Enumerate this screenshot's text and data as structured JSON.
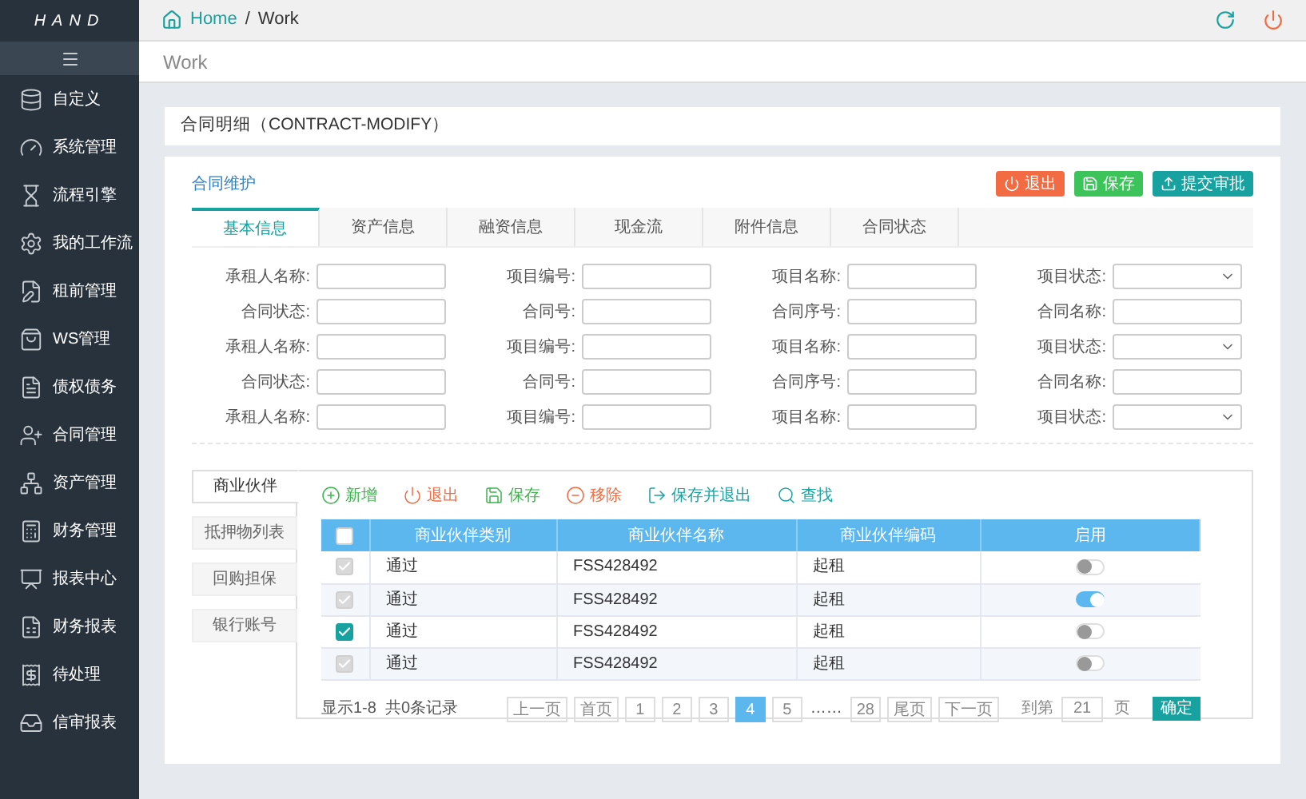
{
  "logo": {
    "text": "HAND"
  },
  "breadcrumb": {
    "home": "Home",
    "separator": "/",
    "current": "Work"
  },
  "page_title": "Work",
  "sidebar": {
    "items": [
      {
        "label": "自定义"
      },
      {
        "label": "系统管理"
      },
      {
        "label": "流程引擎"
      },
      {
        "label": "我的工作流"
      },
      {
        "label": "租前管理"
      },
      {
        "label": "WS管理"
      },
      {
        "label": "债权债务"
      },
      {
        "label": "合同管理"
      },
      {
        "label": "资产管理"
      },
      {
        "label": "财务管理"
      },
      {
        "label": "报表中心"
      },
      {
        "label": "财务报表"
      },
      {
        "label": "待处理"
      },
      {
        "label": "信审报表"
      }
    ]
  },
  "detail_title": "合同明细（CONTRACT-MODIFY）",
  "section_title": "合同维护",
  "actions": [
    {
      "label": "退出",
      "kind": "exit"
    },
    {
      "label": "保存",
      "kind": "save"
    },
    {
      "label": "提交审批",
      "kind": "submit"
    }
  ],
  "tabs": [
    {
      "label": "基本信息",
      "selected": true
    },
    {
      "label": "资产信息",
      "selected": false
    },
    {
      "label": "融资信息",
      "selected": false
    },
    {
      "label": "现金流",
      "selected": false
    },
    {
      "label": "附件信息",
      "selected": false
    },
    {
      "label": "合同状态",
      "selected": false
    }
  ],
  "form_rows": [
    [
      {
        "label": "承租人名称:",
        "kind": "input"
      },
      {
        "label": "项目编号:",
        "kind": "input"
      },
      {
        "label": "项目名称:",
        "kind": "input"
      },
      {
        "label": "项目状态:",
        "kind": "select"
      }
    ],
    [
      {
        "label": "合同状态:",
        "kind": "input"
      },
      {
        "label": "合同号:",
        "kind": "input"
      },
      {
        "label": "合同序号:",
        "kind": "input"
      },
      {
        "label": "合同名称:",
        "kind": "input"
      }
    ],
    [
      {
        "label": "承租人名称:",
        "kind": "input"
      },
      {
        "label": "项目编号:",
        "kind": "input"
      },
      {
        "label": "项目名称:",
        "kind": "input"
      },
      {
        "label": "项目状态:",
        "kind": "select"
      }
    ],
    [
      {
        "label": "合同状态:",
        "kind": "input"
      },
      {
        "label": "合同号:",
        "kind": "input"
      },
      {
        "label": "合同序号:",
        "kind": "input"
      },
      {
        "label": "合同名称:",
        "kind": "input"
      }
    ],
    [
      {
        "label": "承租人名称:",
        "kind": "input"
      },
      {
        "label": "项目编号:",
        "kind": "input"
      },
      {
        "label": "项目名称:",
        "kind": "input"
      },
      {
        "label": "项目状态:",
        "kind": "select"
      }
    ]
  ],
  "side_tabs": [
    {
      "label": "商业伙伴",
      "selected": true
    },
    {
      "label": "抵押物列表",
      "selected": false
    },
    {
      "label": "回购担保",
      "selected": false
    },
    {
      "label": "银行账号",
      "selected": false
    }
  ],
  "toolbar": [
    {
      "label": "新增",
      "kind": "add"
    },
    {
      "label": "退出",
      "kind": "exit"
    },
    {
      "label": "保存",
      "kind": "save"
    },
    {
      "label": "移除",
      "kind": "remove"
    },
    {
      "label": "保存并退出",
      "kind": "save_exit"
    },
    {
      "label": "查找",
      "kind": "search"
    }
  ],
  "table": {
    "columns": [
      "商业伙伴类别",
      "商业伙伴名称",
      "商业伙伴编码",
      "启用"
    ],
    "header_checked": false,
    "rows": [
      {
        "checked": true,
        "disabled": true,
        "type": "通过",
        "name": "FSS428492",
        "code": "起租",
        "on": false
      },
      {
        "checked": true,
        "disabled": true,
        "type": "通过",
        "name": "FSS428492",
        "code": "起租",
        "on": true
      },
      {
        "checked": true,
        "disabled": false,
        "type": "通过",
        "name": "FSS428492",
        "code": "起租",
        "on": false
      },
      {
        "checked": true,
        "disabled": true,
        "type": "通过",
        "name": "FSS428492",
        "code": "起租",
        "on": false
      }
    ]
  },
  "footer": {
    "summary": "显示1-8  共0条记录",
    "pages": [
      {
        "label": "上一页",
        "selected": false
      },
      {
        "label": "首页",
        "selected": false
      },
      {
        "label": "1",
        "selected": false
      },
      {
        "label": "2",
        "selected": false
      },
      {
        "label": "3",
        "selected": false
      },
      {
        "label": "4",
        "selected": true
      },
      {
        "label": "5",
        "selected": false
      },
      {
        "label": "……",
        "kind": "gap"
      },
      {
        "label": "28",
        "selected": false
      },
      {
        "label": "尾页",
        "selected": false
      },
      {
        "label": "下一页",
        "selected": false
      }
    ],
    "goto_label": "到第",
    "goto_value": "21",
    "goto_unit": "页",
    "confirm": "确定"
  }
}
